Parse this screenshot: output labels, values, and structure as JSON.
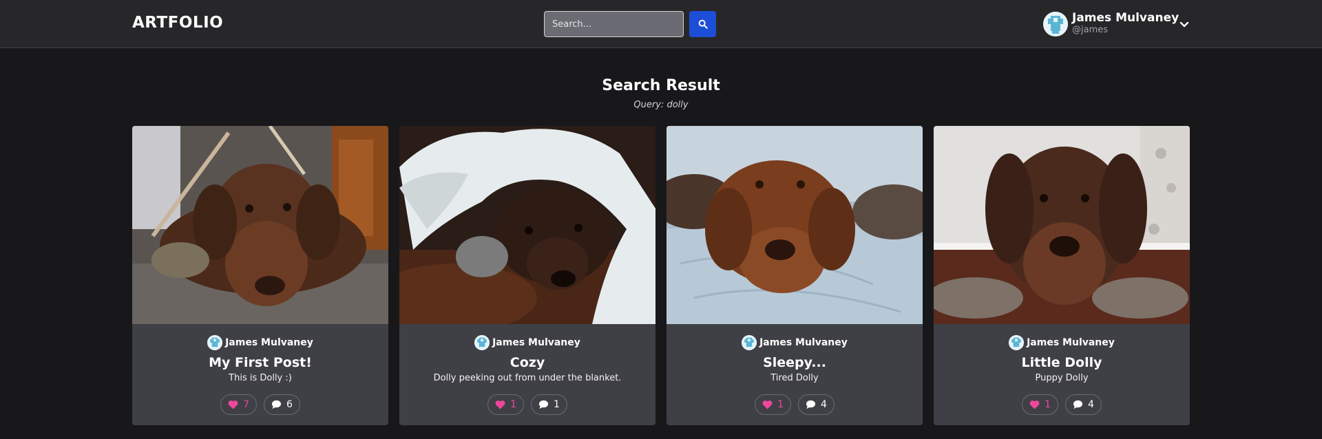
{
  "app": {
    "logo": "ARTFOLIO"
  },
  "header": {
    "search": {
      "placeholder": "Search...",
      "value": ""
    },
    "search_icon": "magnifier-icon",
    "user": {
      "name": "James Mulvaney",
      "handle": "@james"
    },
    "menu_icon": "chevron-down-icon"
  },
  "results": {
    "title": "Search Result",
    "query_label": "Query: dolly"
  },
  "posts": [
    {
      "author": "James Mulvaney",
      "title": "My First Post!",
      "description": "This is Dolly :)",
      "likes": "7",
      "comments": "6"
    },
    {
      "author": "James Mulvaney",
      "title": "Cozy",
      "description": "Dolly peeking out from under the blanket.",
      "likes": "1",
      "comments": "1"
    },
    {
      "author": "James Mulvaney",
      "title": "Sleepy...",
      "description": "Tired Dolly",
      "likes": "1",
      "comments": "4"
    },
    {
      "author": "James Mulvaney",
      "title": "Little Dolly",
      "description": "Puppy Dolly",
      "likes": "1",
      "comments": "4"
    }
  ],
  "colors": {
    "background": "#18181b",
    "header": "#27272a",
    "card": "#3f3f46",
    "accent": "#1d4ed8",
    "like": "#ec4899"
  }
}
